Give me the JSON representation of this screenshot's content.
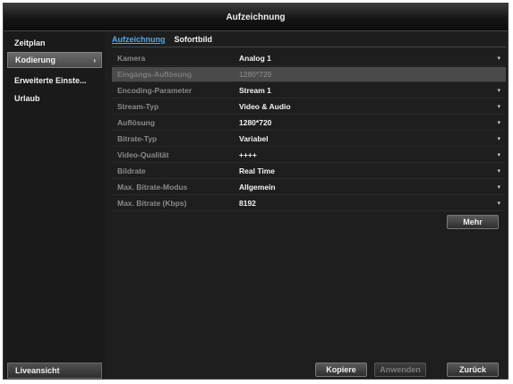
{
  "window": {
    "title": "Aufzeichnung"
  },
  "sidebar": {
    "items": [
      {
        "label": "Zeitplan"
      },
      {
        "label": "Kodierung",
        "chevron": "›"
      },
      {
        "label": "Erweiterte Einste..."
      },
      {
        "label": "Urlaub"
      }
    ],
    "live_label": "Liveansicht"
  },
  "tabs": [
    {
      "label": "Aufzeichnung"
    },
    {
      "label": "Sofortbild"
    }
  ],
  "form": {
    "rows": [
      {
        "label": "Kamera",
        "value": "Analog 1"
      },
      {
        "label": "Eingangs-Auflösung",
        "value": "1280*720"
      },
      {
        "label": "Encoding-Parameter",
        "value": "Stream 1"
      },
      {
        "label": "Stream-Typ",
        "value": "Video & Audio"
      },
      {
        "label": "Auflösung",
        "value": "1280*720"
      },
      {
        "label": "Bitrate-Typ",
        "value": "Variabel"
      },
      {
        "label": "Video-Qualität",
        "value": "++++"
      },
      {
        "label": "Bildrate",
        "value": "Real Time"
      },
      {
        "label": "Max. Bitrate-Modus",
        "value": "Allgemein"
      },
      {
        "label": "Max. Bitrate (Kbps)",
        "value": "8192"
      }
    ],
    "dropdown_arrow": "▾"
  },
  "buttons": {
    "more": "Mehr",
    "copy": "Kopiere",
    "apply": "Anwenden",
    "back": "Zurück"
  },
  "colors": {
    "accent_tab": "#4fa9e8",
    "background": "#1e1e1e"
  }
}
